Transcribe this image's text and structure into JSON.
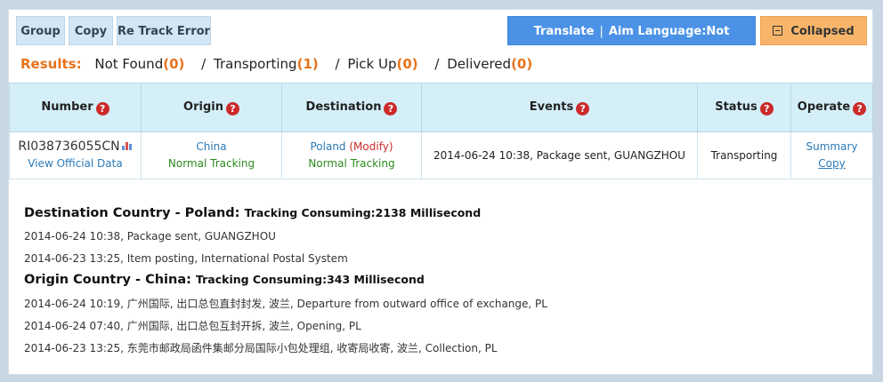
{
  "toolbar": {
    "group_label": "Group",
    "copy_label": "Copy",
    "retrack_label": "Re Track Error",
    "translate_label": "Translate",
    "translate_sep": "|",
    "aim_language_label": "Aim Language:Not Translated",
    "collapsed_label": "Collapsed"
  },
  "results": {
    "label": "Results:",
    "not_found_label": "Not Found",
    "not_found_count": "(0)",
    "transporting_label": "Transporting",
    "transporting_count": "(1)",
    "pickup_label": "Pick Up",
    "pickup_count": "(0)",
    "delivered_label": "Delivered",
    "delivered_count": "(0)",
    "slash": "/"
  },
  "table": {
    "headers": [
      "Number",
      "Origin",
      "Destination",
      "Events",
      "Status",
      "Operate"
    ],
    "help_glyph": "?",
    "row": {
      "number": "RI038736055CN",
      "view_official": "View Official Data",
      "origin_country": "China",
      "origin_tracking": "Normal Tracking",
      "dest_country": "Poland",
      "dest_modify": "(Modify)",
      "dest_tracking": "Normal Tracking",
      "event": "2014-06-24 10:38, Package sent, GUANGZHOU",
      "status": "Transporting",
      "op_summary": "Summary",
      "op_copy": "Copy"
    }
  },
  "details": {
    "destination": {
      "title": "Destination Country - Poland:",
      "consuming": "Tracking Consuming:2138 Millisecond",
      "events": [
        "2014-06-24 10:38, Package sent, GUANGZHOU",
        "2014-06-23 13:25, Item posting, International Postal System"
      ]
    },
    "origin": {
      "title": "Origin Country - China:",
      "consuming": "Tracking Consuming:343 Millisecond",
      "events": [
        "2014-06-24 10:19, 广州国际, 出口总包直封封发, 波兰, Departure from outward office of exchange, PL",
        "2014-06-24 07:40, 广州国际, 出口总包互封开拆, 波兰, Opening, PL",
        "2014-06-23 13:25, 东莞市邮政局函件集邮分局国际小包处理组, 收寄局收寄, 波兰, Collection, PL"
      ]
    }
  },
  "icons": {
    "help": "help-question-icon",
    "chart": "bar-chart-icon",
    "collapse": "minus-square-icon"
  },
  "colors": {
    "accent_orange": "#e8731b",
    "translate_blue": "#4b92e6",
    "collapsed_orange": "#f8b56a",
    "header_bg": "#d5eff9",
    "help_red": "#cc2a2a",
    "link_blue": "#2a7ab8",
    "tracking_green": "#2c8a1e"
  }
}
